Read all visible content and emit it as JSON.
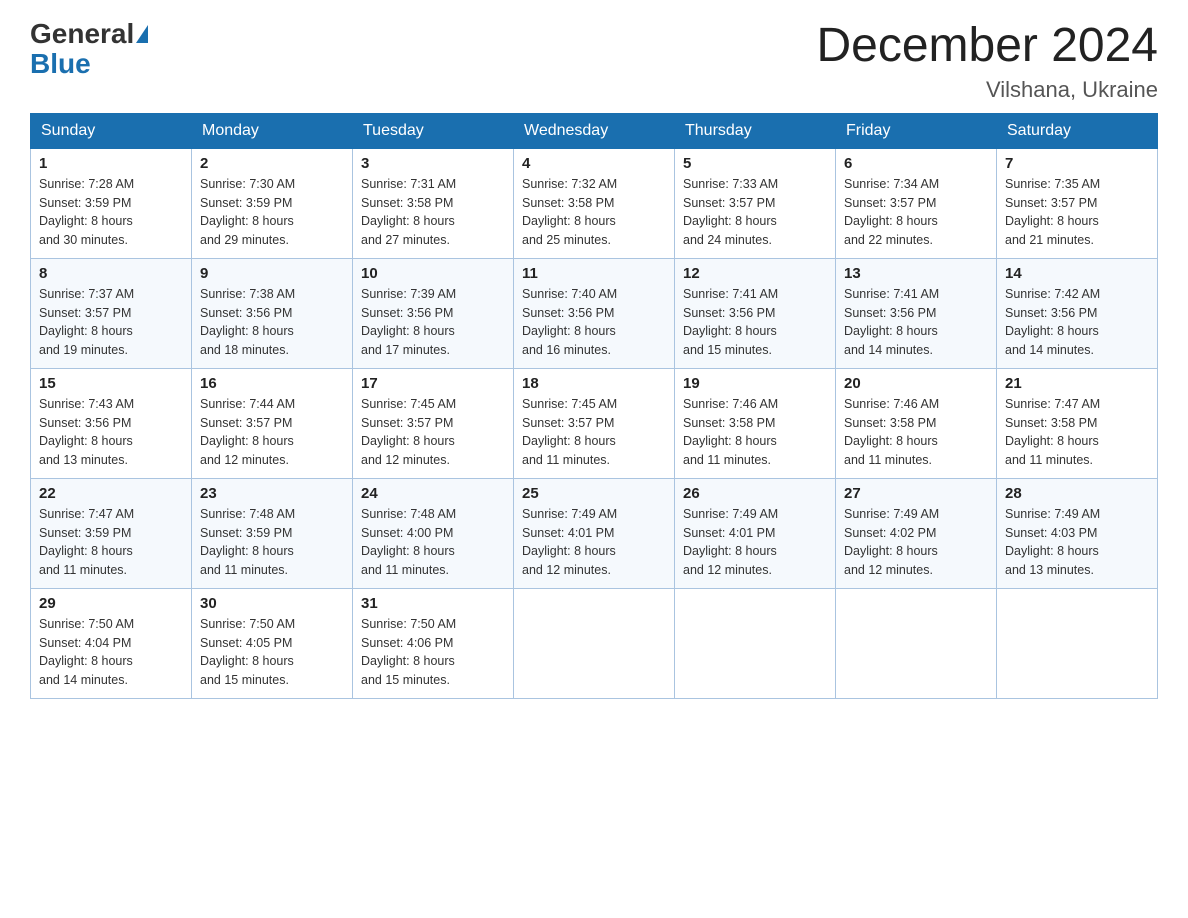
{
  "logo": {
    "general": "General",
    "blue": "Blue"
  },
  "title": {
    "month_year": "December 2024",
    "location": "Vilshana, Ukraine"
  },
  "days_of_week": [
    "Sunday",
    "Monday",
    "Tuesday",
    "Wednesday",
    "Thursday",
    "Friday",
    "Saturday"
  ],
  "weeks": [
    [
      {
        "day": "1",
        "sunrise": "7:28 AM",
        "sunset": "3:59 PM",
        "daylight": "8 hours and 30 minutes."
      },
      {
        "day": "2",
        "sunrise": "7:30 AM",
        "sunset": "3:59 PM",
        "daylight": "8 hours and 29 minutes."
      },
      {
        "day": "3",
        "sunrise": "7:31 AM",
        "sunset": "3:58 PM",
        "daylight": "8 hours and 27 minutes."
      },
      {
        "day": "4",
        "sunrise": "7:32 AM",
        "sunset": "3:58 PM",
        "daylight": "8 hours and 25 minutes."
      },
      {
        "day": "5",
        "sunrise": "7:33 AM",
        "sunset": "3:57 PM",
        "daylight": "8 hours and 24 minutes."
      },
      {
        "day": "6",
        "sunrise": "7:34 AM",
        "sunset": "3:57 PM",
        "daylight": "8 hours and 22 minutes."
      },
      {
        "day": "7",
        "sunrise": "7:35 AM",
        "sunset": "3:57 PM",
        "daylight": "8 hours and 21 minutes."
      }
    ],
    [
      {
        "day": "8",
        "sunrise": "7:37 AM",
        "sunset": "3:57 PM",
        "daylight": "8 hours and 19 minutes."
      },
      {
        "day": "9",
        "sunrise": "7:38 AM",
        "sunset": "3:56 PM",
        "daylight": "8 hours and 18 minutes."
      },
      {
        "day": "10",
        "sunrise": "7:39 AM",
        "sunset": "3:56 PM",
        "daylight": "8 hours and 17 minutes."
      },
      {
        "day": "11",
        "sunrise": "7:40 AM",
        "sunset": "3:56 PM",
        "daylight": "8 hours and 16 minutes."
      },
      {
        "day": "12",
        "sunrise": "7:41 AM",
        "sunset": "3:56 PM",
        "daylight": "8 hours and 15 minutes."
      },
      {
        "day": "13",
        "sunrise": "7:41 AM",
        "sunset": "3:56 PM",
        "daylight": "8 hours and 14 minutes."
      },
      {
        "day": "14",
        "sunrise": "7:42 AM",
        "sunset": "3:56 PM",
        "daylight": "8 hours and 14 minutes."
      }
    ],
    [
      {
        "day": "15",
        "sunrise": "7:43 AM",
        "sunset": "3:56 PM",
        "daylight": "8 hours and 13 minutes."
      },
      {
        "day": "16",
        "sunrise": "7:44 AM",
        "sunset": "3:57 PM",
        "daylight": "8 hours and 12 minutes."
      },
      {
        "day": "17",
        "sunrise": "7:45 AM",
        "sunset": "3:57 PM",
        "daylight": "8 hours and 12 minutes."
      },
      {
        "day": "18",
        "sunrise": "7:45 AM",
        "sunset": "3:57 PM",
        "daylight": "8 hours and 11 minutes."
      },
      {
        "day": "19",
        "sunrise": "7:46 AM",
        "sunset": "3:58 PM",
        "daylight": "8 hours and 11 minutes."
      },
      {
        "day": "20",
        "sunrise": "7:46 AM",
        "sunset": "3:58 PM",
        "daylight": "8 hours and 11 minutes."
      },
      {
        "day": "21",
        "sunrise": "7:47 AM",
        "sunset": "3:58 PM",
        "daylight": "8 hours and 11 minutes."
      }
    ],
    [
      {
        "day": "22",
        "sunrise": "7:47 AM",
        "sunset": "3:59 PM",
        "daylight": "8 hours and 11 minutes."
      },
      {
        "day": "23",
        "sunrise": "7:48 AM",
        "sunset": "3:59 PM",
        "daylight": "8 hours and 11 minutes."
      },
      {
        "day": "24",
        "sunrise": "7:48 AM",
        "sunset": "4:00 PM",
        "daylight": "8 hours and 11 minutes."
      },
      {
        "day": "25",
        "sunrise": "7:49 AM",
        "sunset": "4:01 PM",
        "daylight": "8 hours and 12 minutes."
      },
      {
        "day": "26",
        "sunrise": "7:49 AM",
        "sunset": "4:01 PM",
        "daylight": "8 hours and 12 minutes."
      },
      {
        "day": "27",
        "sunrise": "7:49 AM",
        "sunset": "4:02 PM",
        "daylight": "8 hours and 12 minutes."
      },
      {
        "day": "28",
        "sunrise": "7:49 AM",
        "sunset": "4:03 PM",
        "daylight": "8 hours and 13 minutes."
      }
    ],
    [
      {
        "day": "29",
        "sunrise": "7:50 AM",
        "sunset": "4:04 PM",
        "daylight": "8 hours and 14 minutes."
      },
      {
        "day": "30",
        "sunrise": "7:50 AM",
        "sunset": "4:05 PM",
        "daylight": "8 hours and 15 minutes."
      },
      {
        "day": "31",
        "sunrise": "7:50 AM",
        "sunset": "4:06 PM",
        "daylight": "8 hours and 15 minutes."
      },
      null,
      null,
      null,
      null
    ]
  ],
  "labels": {
    "sunrise": "Sunrise:",
    "sunset": "Sunset:",
    "daylight": "Daylight:"
  }
}
